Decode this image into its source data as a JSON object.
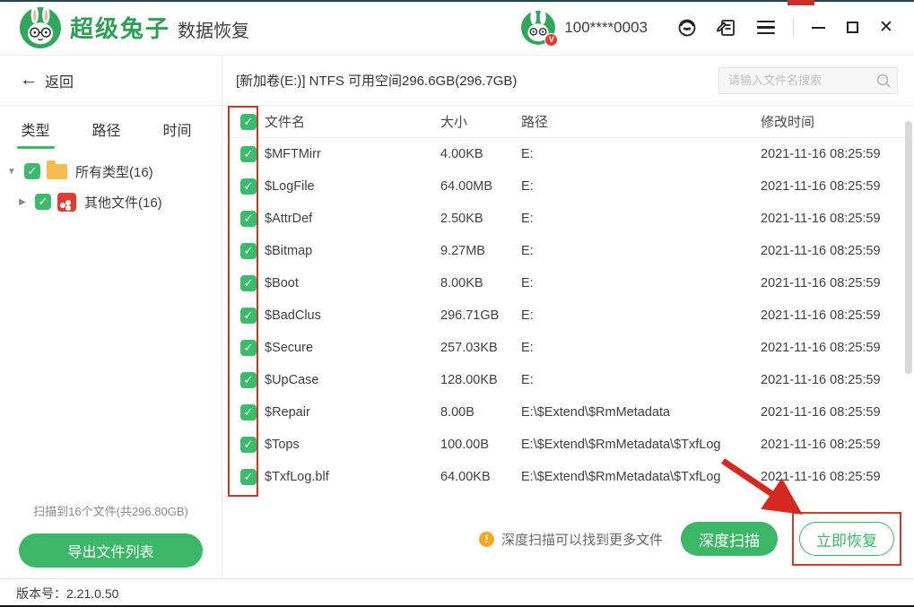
{
  "colors": {
    "accent_green": "#3bb765",
    "title_green": "#2f9e57",
    "annotation_red": "#cf3a2d",
    "warning_orange": "#f7a823",
    "file_icon_red": "#e23c32",
    "folder_yellow": "#f6bc51"
  },
  "titlebar": {
    "app_name": "超级兔子",
    "app_subtitle": "数据恢复",
    "username": "100****0003",
    "avatar_badge": "V",
    "close_glyph": "✕"
  },
  "sidebar": {
    "back_label": "返回",
    "back_arrow": "←",
    "tabs": [
      {
        "label": "类型",
        "active": true
      },
      {
        "label": "路径",
        "active": false
      },
      {
        "label": "时间",
        "active": false
      }
    ],
    "tree": [
      {
        "label": "所有类型(16)",
        "caret": "▼",
        "icon": "folder",
        "checked": true
      },
      {
        "label": "其他文件(16)",
        "caret": "▶",
        "icon": "other-files",
        "checked": true
      }
    ],
    "scan_summary": "扫描到16个文件(共296.80GB)",
    "export_button": "导出文件列表"
  },
  "content": {
    "volume_info": "[新加卷(E:)] NTFS 可用空间296.6GB(296.7GB)",
    "search": {
      "placeholder": "请输入文件名搜索"
    },
    "table": {
      "columns": [
        "文件名",
        "大小",
        "路径",
        "修改时间"
      ],
      "rows": [
        {
          "name": "$MFTMirr",
          "size": "4.00KB",
          "path": "E:",
          "modified": "2021-11-16 08:25:59"
        },
        {
          "name": "$LogFile",
          "size": "64.00MB",
          "path": "E:",
          "modified": "2021-11-16 08:25:59"
        },
        {
          "name": "$AttrDef",
          "size": "2.50KB",
          "path": "E:",
          "modified": "2021-11-16 08:25:59"
        },
        {
          "name": "$Bitmap",
          "size": "9.27MB",
          "path": "E:",
          "modified": "2021-11-16 08:25:59"
        },
        {
          "name": "$Boot",
          "size": "8.00KB",
          "path": "E:",
          "modified": "2021-11-16 08:25:59"
        },
        {
          "name": "$BadClus",
          "size": "296.71GB",
          "path": "E:",
          "modified": "2021-11-16 08:25:59"
        },
        {
          "name": "$Secure",
          "size": "257.03KB",
          "path": "E:",
          "modified": "2021-11-16 08:25:59"
        },
        {
          "name": "$UpCase",
          "size": "128.00KB",
          "path": "E:",
          "modified": "2021-11-16 08:25:59"
        },
        {
          "name": "$Repair",
          "size": "8.00B",
          "path": "E:\\$Extend\\$RmMetadata",
          "modified": "2021-11-16 08:25:59"
        },
        {
          "name": "$Tops",
          "size": "100.00B",
          "path": "E:\\$Extend\\$RmMetadata\\$TxfLog",
          "modified": "2021-11-16 08:25:59"
        },
        {
          "name": "$TxfLog.blf",
          "size": "64.00KB",
          "path": "E:\\$Extend\\$RmMetadata\\$TxfLog",
          "modified": "2021-11-16 08:25:59"
        }
      ]
    },
    "action_bar": {
      "hint": "深度扫描可以找到更多文件",
      "warning_glyph": "!",
      "deep_scan_button": "深度扫描",
      "recover_button": "立即恢复"
    }
  },
  "statusbar": {
    "version": "版本号：2.21.0.50"
  }
}
